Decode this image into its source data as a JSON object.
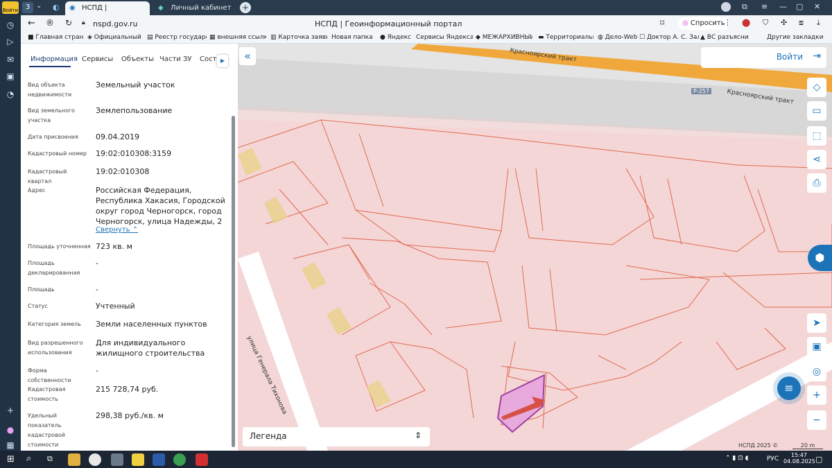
{
  "browser": {
    "profile_label": "Войти",
    "tab_count": "3",
    "tabs": [
      {
        "label": "НСПД | Геоинформаци"
      },
      {
        "label": "Личный кабинет"
      }
    ],
    "url": "nspd.gov.ru",
    "page_title": "НСПД | Геоинформационный портал",
    "ask_label": "Спросить",
    "bookmarks": [
      "Главная страниц",
      "Официальный са",
      "Реестр государст",
      "внешняя ссылка",
      "Карточка заявки",
      "Новая папка",
      "Яндекс",
      "Сервисы Яндекса",
      "МЕЖАРХИВНЫЙ",
      "Территориальнь",
      "Дело-Web",
      "Доктор А. С. Зал",
      "ВС разъясни",
      "Другие закладки"
    ]
  },
  "panel": {
    "tabs": [
      "Информация",
      "Сервисы",
      "Объекты",
      "Части ЗУ",
      "Соста"
    ],
    "fields": [
      {
        "label": "Вид объекта недвижимости",
        "value": "Земельный участок"
      },
      {
        "label": "Вид земельного участка",
        "value": "Землепользование"
      },
      {
        "label": "Дата присвоения",
        "value": "09.04.2019"
      },
      {
        "label": "Кадастровый номер",
        "value": "19:02:010308:3159"
      },
      {
        "label": "Кадастровый квартал",
        "value": "19:02:010308"
      },
      {
        "label": "Адрес",
        "value": "Российская Федерация, Республика Хакасия, Городской округ город Черногорск, город Черногорск, улица Надежды, 2"
      },
      {
        "label": "Площадь уточненная",
        "value": "723 кв. м"
      },
      {
        "label": "Площадь декларированная",
        "value": "-"
      },
      {
        "label": "Площадь",
        "value": "-"
      },
      {
        "label": "Статус",
        "value": "Учтенный"
      },
      {
        "label": "Категория земель",
        "value": "Земли населенных пунктов"
      },
      {
        "label": "Вид разрешенного использования",
        "value": "Для индивидуального жилищного строительства"
      },
      {
        "label": "Форма собственности",
        "value": "-"
      },
      {
        "label": "Кадастровая стоимость",
        "value": "215 728,74 руб."
      },
      {
        "label": "Удельный показатель кадастровой стоимости",
        "value": "298,38 руб./кв. м"
      }
    ],
    "collapse_label": "Свернуть"
  },
  "map": {
    "login_label": "Войти",
    "road_label_1": "Красноярский тракт",
    "road_label_2": "Красноярский тракт",
    "road_badge": "Р-257",
    "street_label": "улица Генерала Тихонова",
    "legend_label": "Легенда",
    "attribution": "НСПД 2025 ©",
    "scale_label": "20 m"
  },
  "taskbar": {
    "lang": "РУС",
    "time": "15:47",
    "date": "04.08.2025"
  }
}
